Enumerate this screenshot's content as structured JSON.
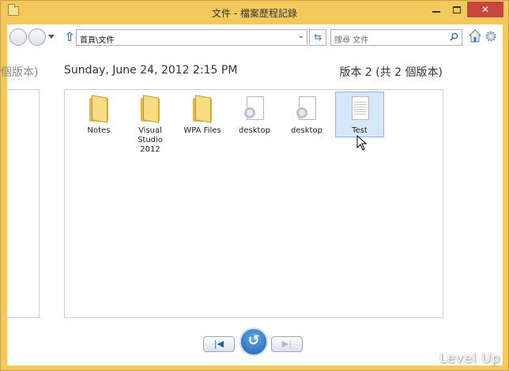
{
  "window": {
    "title": "文件 - 檔案歷程記錄",
    "minimize_label": "",
    "maximize_label": "",
    "close_label": "✕"
  },
  "toolbar": {
    "address_path": "首頁\\文件",
    "search_placeholder": "搜尋 文件",
    "back_icon": "back-circle-icon",
    "forward_icon": "forward-circle-icon",
    "up_icon": "up-arrow-icon",
    "refresh_glyph": "⇆"
  },
  "previous_version": {
    "label_fragment": "個版本)"
  },
  "current_version": {
    "datetime": "Sunday, June 24, 2012 2:15 PM",
    "version_label": "版本 2 (共 2 個版本)",
    "files": [
      {
        "name": "Notes",
        "type": "folder"
      },
      {
        "name": "Visual\nStudio\n2012",
        "type": "folder"
      },
      {
        "name": "WPA Files",
        "type": "folder"
      },
      {
        "name": "desktop",
        "type": "system-file"
      },
      {
        "name": "desktop",
        "type": "system-file"
      },
      {
        "name": "Test",
        "type": "text-file",
        "selected": true
      }
    ]
  },
  "playback": {
    "previous_glyph": "|◀",
    "restore_glyph": "↺",
    "next_glyph": "▶|"
  },
  "watermark": "Level Up",
  "colors": {
    "frame": "#f4c95c",
    "close_button": "#c7473c",
    "selection": "#d6e7f8",
    "accent_blue": "#2f77c8"
  }
}
